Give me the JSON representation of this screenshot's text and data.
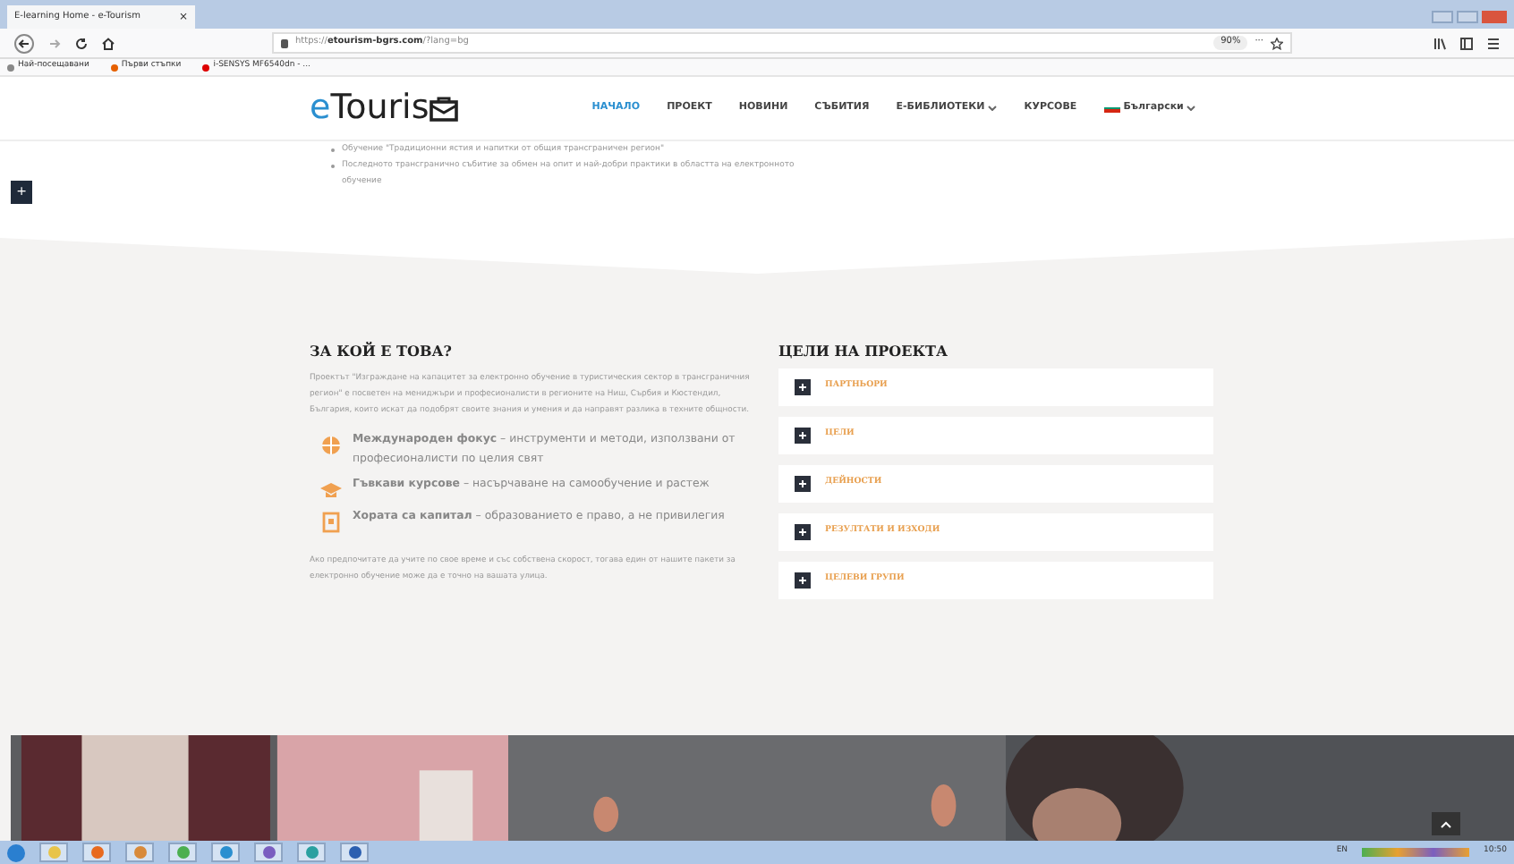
{
  "browser": {
    "tab_title": "E-learning Home - e-Tourism",
    "tab_close": "×",
    "url_prefix": "https://",
    "url_domain": "etourism-bgrs.com",
    "url_path": "/?lang=bg",
    "zoom": "90%",
    "page_actions": "···",
    "bookmarks": [
      "Най-посещавани",
      "Първи стъпки",
      "i-SENSYS MF6540dn - ..."
    ]
  },
  "site": {
    "logo": "eTouris",
    "nav": [
      {
        "label": "НАЧАЛО",
        "selected": true,
        "dropdown": false
      },
      {
        "label": "ПРОЕКТ",
        "selected": false,
        "dropdown": false
      },
      {
        "label": "НОВИНИ",
        "selected": false,
        "dropdown": false
      },
      {
        "label": "СЪБИТИЯ",
        "selected": false,
        "dropdown": false
      },
      {
        "label": "E-БИБЛИОТЕКИ",
        "selected": false,
        "dropdown": true
      },
      {
        "label": "КУРСОВЕ",
        "selected": false,
        "dropdown": false
      },
      {
        "label": "Български",
        "selected": false,
        "dropdown": true
      }
    ]
  },
  "top_bullets": [
    "Обучение \"Традиционни ястия и напитки от общия трансграничен регион\"",
    "Последното трансгранично събитие за обмен на опит и най-добри практики в областта на електронното обучение"
  ],
  "side_button": "+",
  "about": {
    "title": "ЗА КОЙ Е ТОВА?",
    "intro": "Проектът \"Изграждане на капацитет за електронно обучение в туристическия сектор в трансграничния регион\" е посветен на мениджъри и професионалисти в регионите на Ниш, Сърбия и Кюстендил, България, които искат да подобрят своите знания и умения и да направят разлика в техните общности.",
    "features": [
      {
        "kind": "globe",
        "text": "**Международен фокус** – инструменти и методи, използвани от професионалисти по целия свят"
      },
      {
        "kind": "cap",
        "text": "**Гъвкави курсове** – насърчаване на самообучение и растеж"
      },
      {
        "kind": "book",
        "text": "**Хората са капитал** – образованието е право, а не привилегия"
      }
    ],
    "outro": "Ако предпочитате да учите по свое време и със собствена скорост, тогава един от нашите пакети за електронно обучение може да е точно на вашата улица."
  },
  "goals": {
    "title": "ЦЕЛИ НА ПРОЕКТА",
    "items": [
      {
        "label": "ПАРТНЬОРИ",
        "expanded": false
      },
      {
        "label": "ЦЕЛИ",
        "expanded": false
      },
      {
        "label": "ДЕЙНОСТИ",
        "expanded": false
      },
      {
        "label": "РЕЗУЛТАТИ И ИЗХОДИ",
        "expanded": false
      },
      {
        "label": "ЦЕЛЕВИ ГРУПИ",
        "expanded": false
      }
    ]
  },
  "photo": {
    "kind": "picture"
  },
  "taskbar": {
    "language": "EN",
    "time": "10:50"
  }
}
